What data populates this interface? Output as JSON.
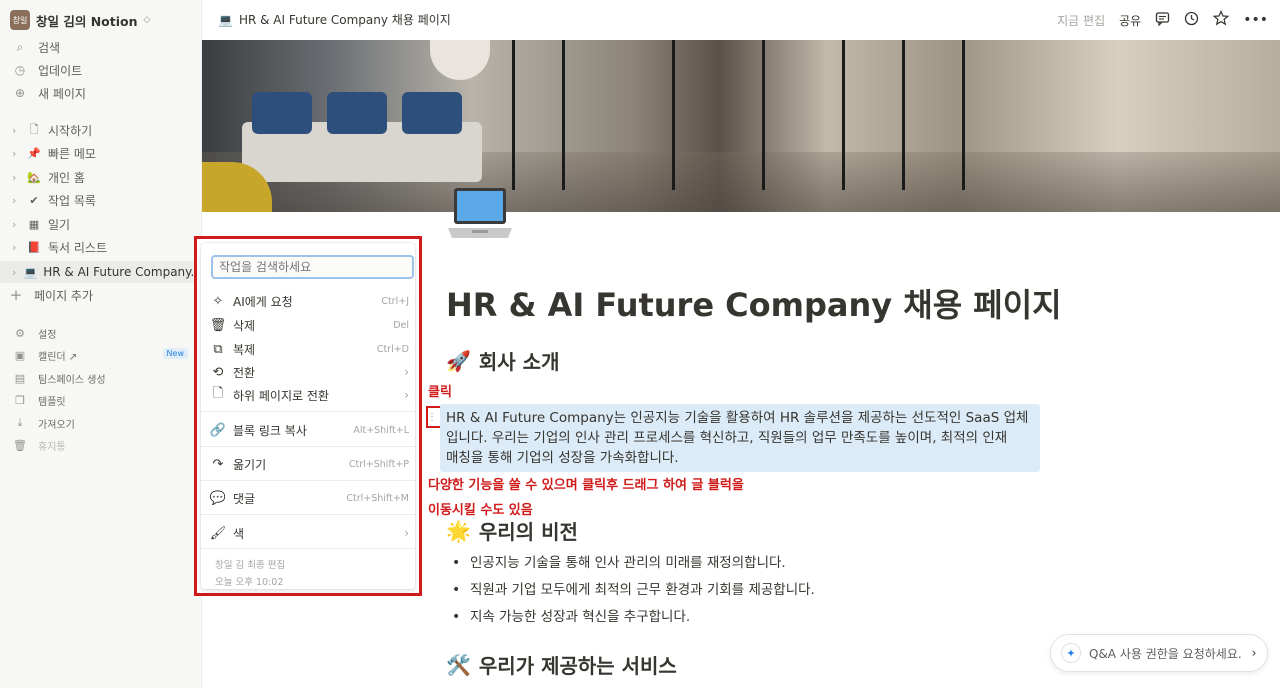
{
  "workspace": {
    "avatar": "창일",
    "name": "창일 김의 Notion",
    "chev": "◇"
  },
  "sidebar": {
    "top": [
      {
        "icon": "⌕",
        "label": "검색"
      },
      {
        "icon": "◷",
        "label": "업데이트"
      },
      {
        "icon": "⊕",
        "label": "새 페이지"
      }
    ],
    "pages": [
      {
        "emoji": "🗋",
        "label": "시작하기"
      },
      {
        "emoji": "📌",
        "label": "빠른 메모"
      },
      {
        "emoji": "🏡",
        "label": "개인 홈"
      },
      {
        "emoji": "✔",
        "label": "작업 목록"
      },
      {
        "emoji": "▦",
        "label": "일기"
      },
      {
        "emoji": "📕",
        "label": "독서 리스트"
      },
      {
        "emoji": "💻",
        "label": "HR & AI Future Company..."
      }
    ],
    "add_page": "페이지 추가",
    "bottom": [
      {
        "icon": "⚙",
        "label": "설정"
      },
      {
        "icon": "▣",
        "label": "캘린더 ↗",
        "badge": "New"
      },
      {
        "icon": "▤",
        "label": "팀스페이스 생성"
      },
      {
        "icon": "❐",
        "label": "템플릿"
      },
      {
        "icon": "⤓",
        "label": "가져오기"
      },
      {
        "icon": "🗑",
        "label": "휴지통"
      }
    ]
  },
  "topbar": {
    "crumb_icon": "💻",
    "crumb": "HR & AI Future Company 채용 페이지",
    "edited": "지금 편집",
    "share": "공유",
    "icons": [
      "comment-icon",
      "clock-icon",
      "star-icon",
      "more-icon"
    ]
  },
  "page": {
    "title": "HR & AI Future Company 채용 페이지",
    "sections": [
      {
        "emoji": "🚀",
        "heading": "회사 소개"
      },
      {
        "emoji": "🌟",
        "heading": "우리의 비전"
      },
      {
        "emoji": "🛠️",
        "heading": "우리가 제공하는 서비스"
      }
    ],
    "paragraph": [
      "HR & AI Future Company는 인공지능 기술을 활용하여 HR 솔루션을 제공하는 선도적인 SaaS 업체",
      "입니다. 우리는 기업의 인사 관리 프로세스를 혁신하고, 직원들의 업무 만족도를 높이며, 최적의 인재",
      "매칭을 통해 기업의 성장을 가속화합니다."
    ],
    "bullets": [
      "인공지능 기술을 통해 인사 관리의 미래를 재정의합니다.",
      "직원과 기업 모두에게 최적의 근무 환경과 기회를 제공합니다.",
      "지속 가능한 성장과 혁신을 추구합니다."
    ]
  },
  "annotations": {
    "click": "클릭",
    "desc1": "다양한 기능을 쓸 수 있으며 클릭후 드래그 하여 글 블럭을",
    "desc2": "이동시킬 수도 있음"
  },
  "menu": {
    "search_placeholder": "작업을 검색하세요",
    "items": [
      {
        "icon": "✧",
        "label": "AI에게 요청",
        "shortcut": "Ctrl+J"
      },
      {
        "icon": "🗑",
        "label": "삭제",
        "shortcut": "Del"
      },
      {
        "icon": "⧉",
        "label": "복제",
        "shortcut": "Ctrl+D"
      },
      {
        "icon": "⟲",
        "label": "전환",
        "arrow": "›"
      },
      {
        "icon": "🗋",
        "label": "하위 페이지로 전환",
        "arrow": "›"
      },
      {
        "icon": "🔗",
        "label": "블록 링크 복사",
        "shortcut": "Alt+Shift+L"
      },
      {
        "icon": "↷",
        "label": "옮기기",
        "shortcut": "Ctrl+Shift+P"
      },
      {
        "icon": "💬",
        "label": "댓글",
        "shortcut": "Ctrl+Shift+M"
      },
      {
        "icon": "🖌",
        "label": "색",
        "arrow": "›"
      }
    ],
    "footer_editor": "창일 김 최종 편집",
    "footer_time": "오늘 오후 10:02"
  },
  "qa": {
    "label": "Q&A 사용 권한을 요청하세요.",
    "arrow": "›"
  },
  "colors": {
    "highlight": "#dcebf8",
    "annotation": "#d11a1a",
    "accent": "#2383e2"
  }
}
